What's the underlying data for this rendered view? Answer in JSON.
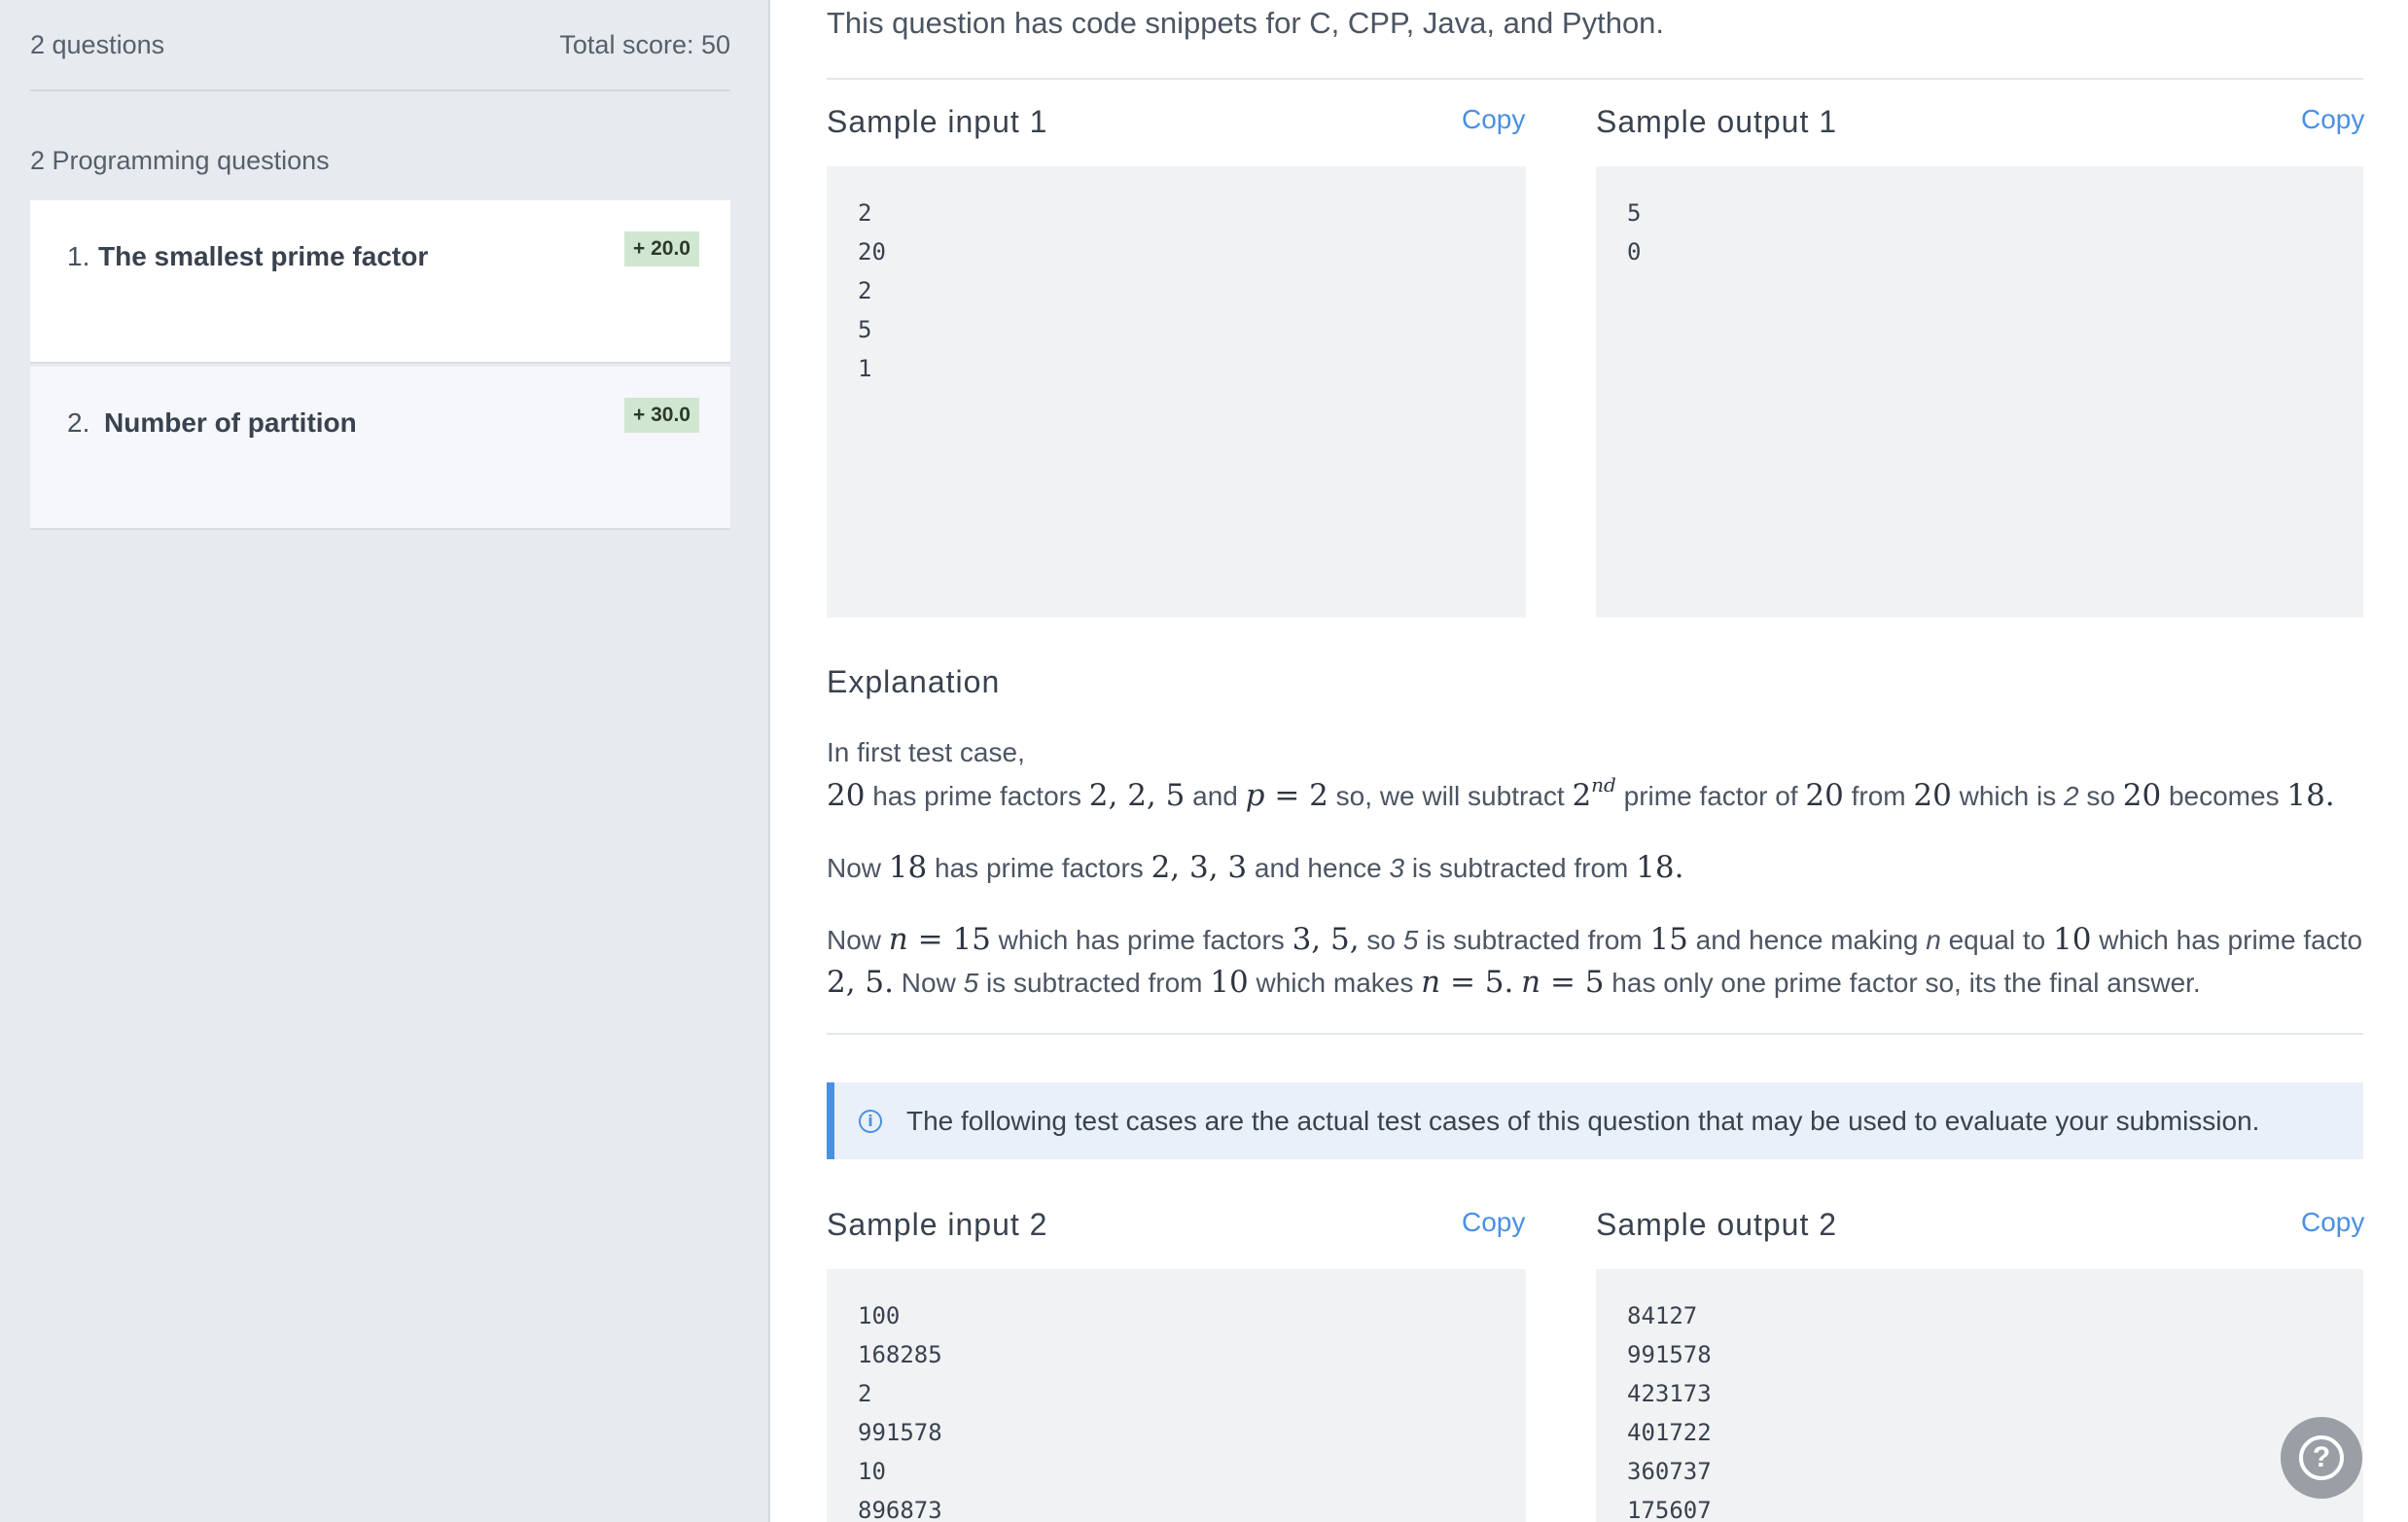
{
  "sidebar": {
    "question_count": "2 questions",
    "total_score": "Total score: 50",
    "section_title": "2 Programming questions",
    "questions": [
      {
        "number": "1.",
        "title": "The smallest prime factor",
        "score": "+ 20.0"
      },
      {
        "number": "2.",
        "title": "Number of partition",
        "score": "+ 30.0"
      }
    ]
  },
  "main": {
    "intro": "This question has code snippets for C, CPP, Java, and Python.",
    "sample1": {
      "input_title": "Sample input 1",
      "output_title": "Sample output 1",
      "copy_label": "Copy",
      "input_lines": [
        "2",
        "20",
        "2",
        "5",
        "1"
      ],
      "output_lines": [
        "5",
        "0"
      ]
    },
    "explanation": {
      "title": "Explanation",
      "line1": "In first test case,",
      "line2": {
        "n20": "20",
        "t1": " has prime factors ",
        "m1": "2, 2, 5",
        "t2": " and ",
        "p": "p",
        "eq": " = 2",
        "t3": " so, we will subtract ",
        "two": "2",
        "sup": "nd",
        "t4": " prime factor of ",
        "n20b": "20",
        "t5": " from ",
        "n20c": "20",
        "t6": " which is ",
        "it2": "2",
        "t7": " so ",
        "n20d": "20",
        "t8": " becomes ",
        "n18": "18."
      },
      "line3": {
        "t1": "Now ",
        "n18": "18",
        "t2": " has prime factors ",
        "m1": "2, 3, 3",
        "t3": " and hence ",
        "it3": "3",
        "t4": " is subtracted from ",
        "n18b": "18."
      },
      "line4": {
        "t1": "Now ",
        "n": "n",
        "eq": " = 15",
        "t2": " which has prime factors ",
        "m1": "3, 5,",
        "t3": " so ",
        "it5": "5",
        "t4": " is subtracted from ",
        "n15": "15",
        "t5": " and hence making ",
        "itn": "n",
        "t6": " equal to ",
        "n10": "10",
        "t7": " which has prime factors"
      },
      "line5": {
        "m1": "2, 5.",
        "t1": " Now ",
        "it5": "5",
        "t2": " is subtracted from ",
        "n10": "10",
        "t3": " which makes ",
        "n": "n",
        "eq": " = 5.",
        "n2": "n",
        "eq2": " = 5",
        "t4": " has only one prime factor so, its the final answer."
      }
    },
    "notice": "The following test cases are the actual test cases of this question that may be used to evaluate your submission.",
    "sample2": {
      "input_title": "Sample input 2",
      "output_title": "Sample output 2",
      "copy_label": "Copy",
      "input_lines": [
        "100",
        "168285",
        "2",
        "991578",
        "10",
        "896873"
      ],
      "output_lines": [
        "84127",
        "991578",
        "423173",
        "401722",
        "360737",
        "175607"
      ]
    },
    "help_icon": "question-circle-icon"
  }
}
